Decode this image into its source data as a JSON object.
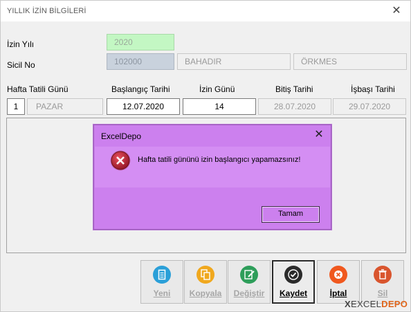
{
  "window": {
    "title": "YILLIK İZİN BİLGİLERİ",
    "close_glyph": "✕"
  },
  "form": {
    "izin_yili_label": "İzin Yılı",
    "izin_yili_value": "2020",
    "sicil_label": "Sicil No",
    "sicil_value": "102000",
    "ad_value": "BAHADIR",
    "soyad_value": "ÖRKMES"
  },
  "columns": {
    "hafta_tatili": "Hafta Tatili Günü",
    "baslangic": "Başlangıç Tarihi",
    "izin_gunu": "İzin Günü",
    "bitis": "Bitiş Tarihi",
    "isbasi": "İşbaşı Tarihi"
  },
  "row": {
    "hafta_no": "1",
    "hafta_gun": "PAZAR",
    "baslangic": "12.07.2020",
    "izin_gunu": "14",
    "bitis": "28.07.2020",
    "isbasi": "29.07.2020"
  },
  "dialog": {
    "title": "ExcelDepo",
    "close_glyph": "✕",
    "message": "Hafta tatili gününü izin başlangıcı yapamazsınız!",
    "ok_label": "Tamam",
    "icon": "error-icon"
  },
  "buttons": [
    {
      "label": "Yeni",
      "icon": "new-document-icon",
      "color": "#2a9fd8"
    },
    {
      "label": "Kopyala",
      "icon": "copy-icon",
      "color": "#f0a81e"
    },
    {
      "label": "Değiştir",
      "icon": "edit-icon",
      "color": "#2e9e5a"
    },
    {
      "label": "Kaydet",
      "icon": "check-icon",
      "color": "#2b2b2b"
    },
    {
      "label": "İptal",
      "icon": "cancel-icon",
      "color": "#f0581e"
    },
    {
      "label": "Sil",
      "icon": "trash-icon",
      "color": "#d9552e"
    }
  ],
  "logo": {
    "x": "X",
    "excel": "EXCEL",
    "depo": "DEPO"
  },
  "colors": {
    "dialog_bg": "#cc80ee",
    "year_field_bg": "#c3f7c3",
    "sicil_field_bg": "#c9d2dd"
  }
}
